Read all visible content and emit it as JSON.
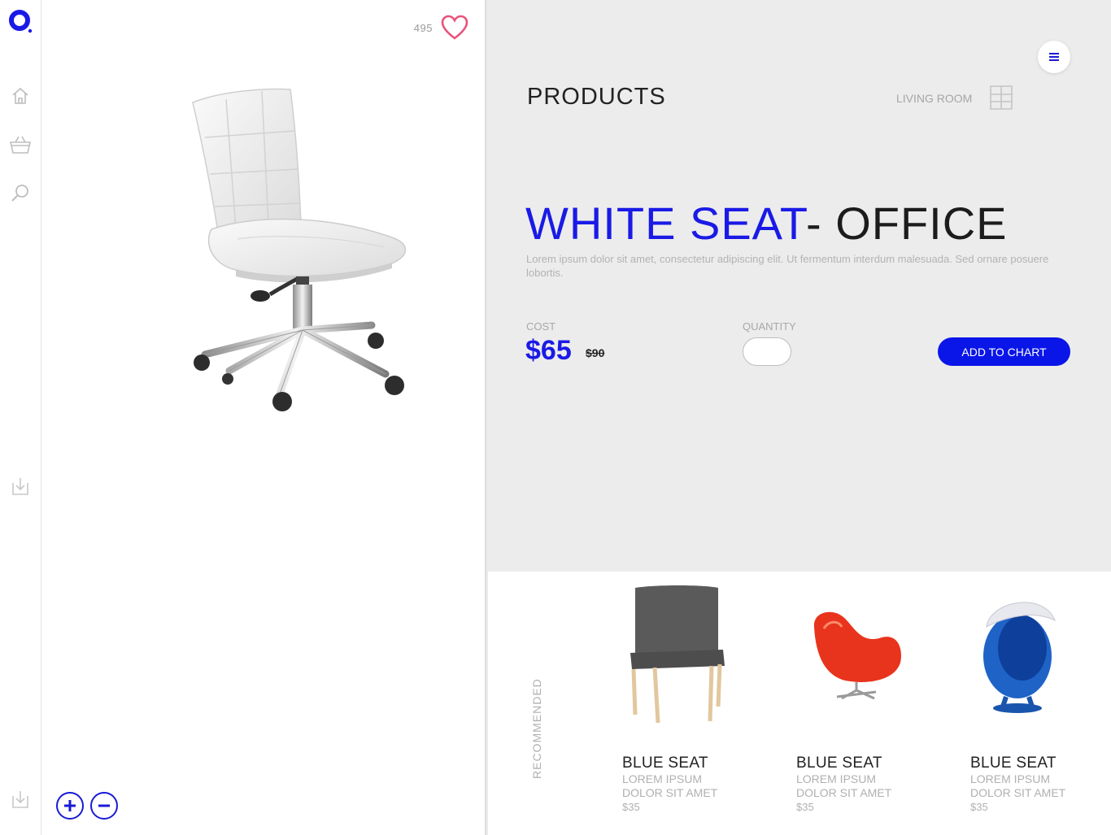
{
  "likes": {
    "count": "495"
  },
  "details": {
    "section_title": "PRODUCTS",
    "category": "LIVING ROOM",
    "title_highlight": "WHITE SEAT",
    "title_rest": "- OFFICE",
    "description": "Lorem ipsum dolor sit amet, consectetur adipiscing elit. Ut fermentum interdum malesuada. Sed ornare posuere lobortis.",
    "cost_label": "COST",
    "price": "$65",
    "old_price": "$90",
    "quantity_label": "QUANTITY",
    "quantity_value": "",
    "add_button": "ADD TO CHART"
  },
  "recommended": {
    "label": "RECOMMENDED",
    "items": [
      {
        "name": "BLUE SEAT",
        "line1": "LOREM IPSUM",
        "line2": "DOLOR SIT AMET",
        "price": "$35"
      },
      {
        "name": "BLUE SEAT",
        "line1": "LOREM IPSUM",
        "line2": "DOLOR SIT AMET",
        "price": "$35"
      },
      {
        "name": "BLUE SEAT",
        "line1": "LOREM IPSUM",
        "line2": "DOLOR SIT AMET",
        "price": "$35"
      }
    ]
  },
  "colors": {
    "accent": "#1a1ae6",
    "button": "#0a16e8",
    "heart": "#e8537a",
    "panel": "#ececec"
  },
  "icons": [
    "logo-icon",
    "home-icon",
    "basket-icon",
    "search-icon",
    "download-icon",
    "heart-icon",
    "zoom-in-icon",
    "zoom-out-icon",
    "menu-icon",
    "shelf-icon"
  ]
}
